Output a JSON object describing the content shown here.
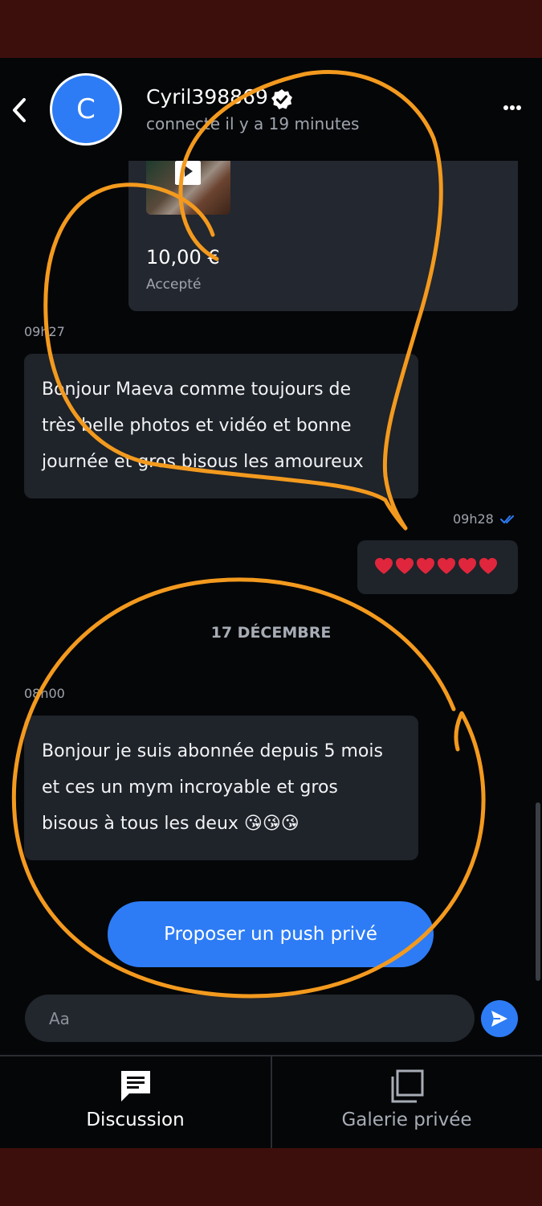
{
  "header": {
    "avatar_letter": "C",
    "username": "Cyril398869",
    "status": "connecté il y a 19 minutes",
    "icons": {
      "back": "chevron-left-icon",
      "verified": "verified-badge-icon",
      "more": "more-horizontal-icon"
    }
  },
  "offer": {
    "price": "10,00 €",
    "state": "Accepté",
    "icons": {
      "play": "play-icon"
    }
  },
  "messages": [
    {
      "time": "09h27",
      "text_lines": [
        "Bonjour Maeva comme toujours de",
        "très belle photos et vidéo et bonne",
        "journée et gros bisous les amoureux"
      ]
    },
    {
      "time": "09h28",
      "text": "❤️❤️❤️❤️❤️❤️",
      "read": true
    },
    {
      "time": "08h00",
      "text_lines": [
        "Bonjour je suis abonnée depuis 5 mois",
        "et ces un mym incroyable et gros",
        "bisous à tous les deux 😘😘😘"
      ]
    }
  ],
  "date_separator": "17 DÉCEMBRE",
  "push_button": "Proposer un push privé",
  "composer": {
    "placeholder": "Aa",
    "send_icon": "send-icon"
  },
  "tabs": [
    {
      "label": "Discussion",
      "icon": "chat-icon",
      "active": true
    },
    {
      "label": "Galerie privée",
      "icon": "gallery-icon",
      "active": false
    }
  ],
  "colors": {
    "accent": "#2d7cf5",
    "background": "#050608",
    "bubble": "#1f232a",
    "frame": "#3d0f0c",
    "annotation": "#f39a1e",
    "heart": "#e0263c"
  }
}
